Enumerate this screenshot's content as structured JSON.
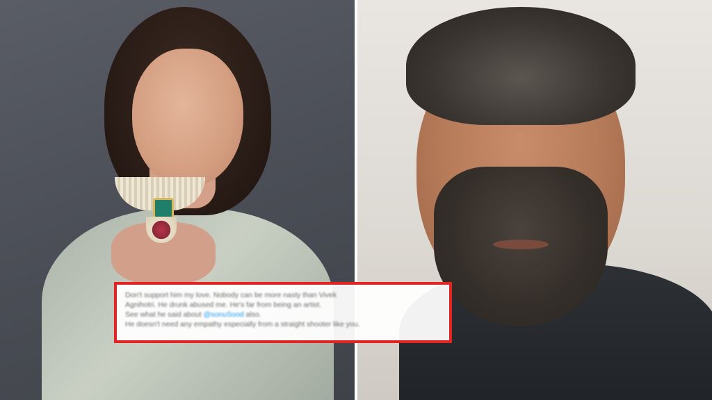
{
  "tweet": {
    "lines": [
      "Don't support him my love. Nobody can be more nasty than Vivek",
      "Agnihotri. He drunk abused me. He's far from being an artist.",
      "See what he said about",
      "He doesn't need any empathy especially from a straight shooter like you."
    ],
    "line3_mention": "@sonuSood",
    "line3_suffix": " also.",
    "border_color": "#e12525"
  }
}
